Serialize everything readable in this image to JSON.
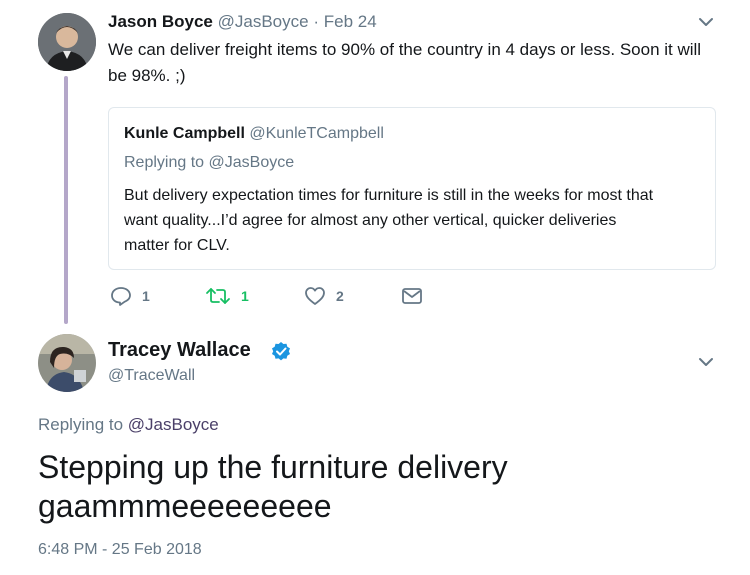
{
  "tweet1": {
    "name": "Jason Boyce",
    "handle": "@JasBoyce",
    "separator": "·",
    "date": "Feb 24",
    "text_line1": "We can deliver freight items to 90% of the country in 4 days or less.  Soon it will",
    "text_line2": "be 98%.  ;)",
    "quote": {
      "name": "Kunle Campbell",
      "handle": "@KunleTCampbell",
      "replying_label": "Replying to ",
      "replying_handle": "@JasBoyce",
      "line1": "But delivery expectation times for furniture is still in the weeks for most that",
      "line2": "want quality...I’d agree for almost any other vertical, quicker deliveries",
      "line3": "matter for CLV."
    },
    "actions": {
      "reply_count": "1",
      "retweet_count": "1",
      "like_count": "2"
    }
  },
  "tweet2": {
    "name": "Tracey Wallace",
    "handle": "@TraceWall",
    "verified": true,
    "replying_label": "Replying to ",
    "replying_handle": "@JasBoyce",
    "text_line1": "Stepping up the furniture delivery",
    "text_line2": "gaammmeeeeeeeee",
    "timestamp": "6:48 PM - 25 Feb 2018"
  },
  "colors": {
    "link": "#1b95e0",
    "muted": "#657786",
    "retweet_green": "#17bf63",
    "thread_line": "#b4a7c9"
  }
}
